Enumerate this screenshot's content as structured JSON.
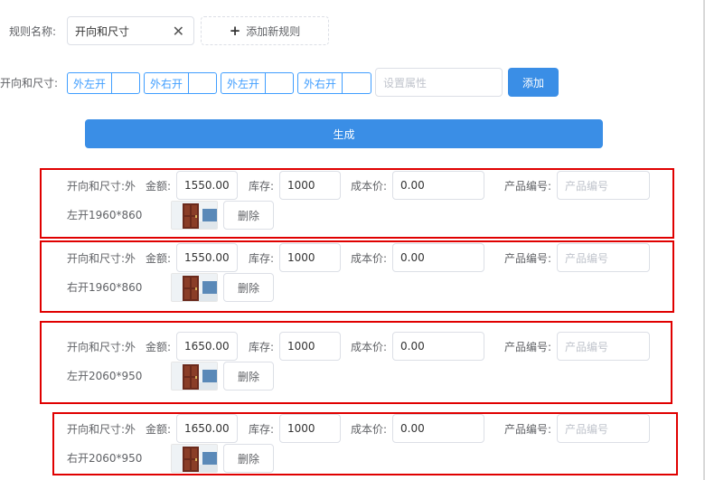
{
  "rule": {
    "name_label": "规则名称:",
    "name_value": "开向和尺寸",
    "add_rule_label": "添加新规则"
  },
  "attr": {
    "label": "开向和尺寸:",
    "tags": [
      "外左开",
      "外右开",
      "外左开",
      "外右开"
    ],
    "input_placeholder": "设置属性",
    "add_label": "添加"
  },
  "generate_label": "生成",
  "variants": [
    {
      "spec_line1": "开向和尺寸:外",
      "spec_line2": "左开1960*860",
      "amount_label": "金额:",
      "amount": "1550.00",
      "stock_label": "库存:",
      "stock": "1000",
      "cost_label": "成本价:",
      "cost": "0.00",
      "code_label": "产品编号:",
      "code_placeholder": "产品编号",
      "delete_label": "删除"
    },
    {
      "spec_line1": "开向和尺寸:外",
      "spec_line2": "右开1960*860",
      "amount_label": "金额:",
      "amount": "1550.00",
      "stock_label": "库存:",
      "stock": "1000",
      "cost_label": "成本价:",
      "cost": "0.00",
      "code_label": "产品编号:",
      "code_placeholder": "产品编号",
      "delete_label": "删除"
    },
    {
      "spec_line1": "开向和尺寸:外",
      "spec_line2": "左开2060*950",
      "amount_label": "金额:",
      "amount": "1650.00",
      "stock_label": "库存:",
      "stock": "1000",
      "cost_label": "成本价:",
      "cost": "0.00",
      "code_label": "产品编号:",
      "code_placeholder": "产品编号",
      "delete_label": "删除"
    },
    {
      "spec_line1": "开向和尺寸:外",
      "spec_line2": "右开2060*950",
      "amount_label": "金额:",
      "amount": "1650.00",
      "stock_label": "库存:",
      "stock": "1000",
      "cost_label": "成本价:",
      "cost": "0.00",
      "code_label": "产品编号:",
      "code_placeholder": "产品编号",
      "delete_label": "删除"
    }
  ],
  "colors": {
    "primary": "#3a8ee6",
    "tag_blue": "#409eff",
    "highlight_red": "#e00000"
  }
}
